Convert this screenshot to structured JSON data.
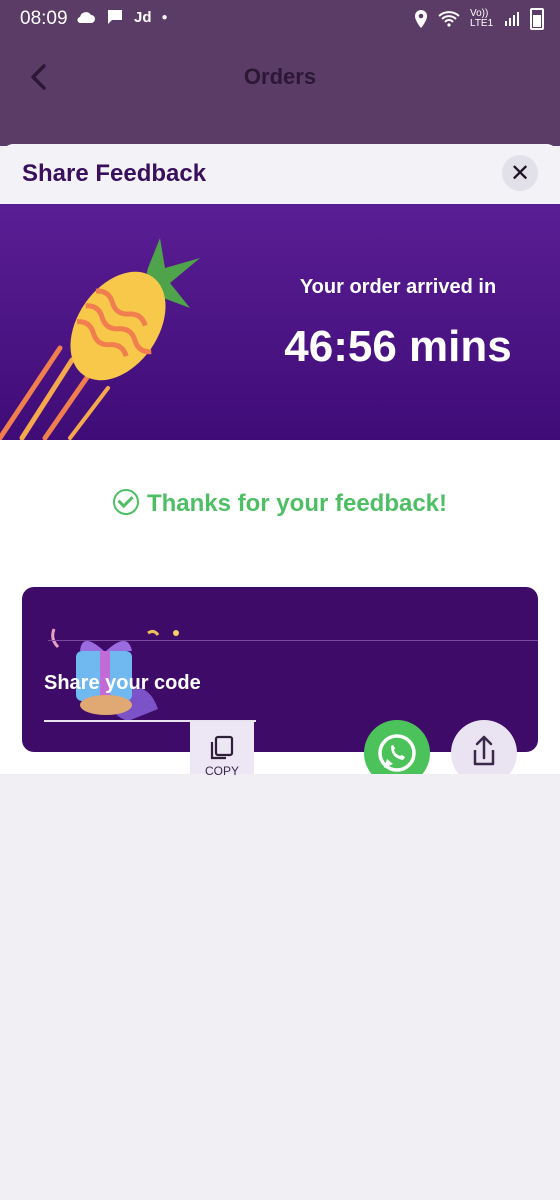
{
  "status_bar": {
    "time": "08:09",
    "carrier_indicator": "Jd",
    "network": "Vo)) LTE1"
  },
  "app_bar": {
    "title": "Orders"
  },
  "sheet": {
    "title": "Share Feedback",
    "close_glyph": "✕",
    "banner": {
      "arrived_text": "Your order arrived in",
      "duration": "46:56 mins"
    },
    "thanks_text": "Thanks for your feedback!",
    "share_card": {
      "label": "Share your code"
    },
    "copy_label": "COPY"
  },
  "colors": {
    "brand_purple": "#3f0b68",
    "success_green": "#4fbf65",
    "whatsapp_green": "#4bc25a"
  },
  "icons": [
    "back-arrow-icon",
    "close-icon",
    "check-circle-icon",
    "copy-icon",
    "whatsapp-icon",
    "share-icon",
    "pineapple-illustration",
    "gift-illustration"
  ]
}
